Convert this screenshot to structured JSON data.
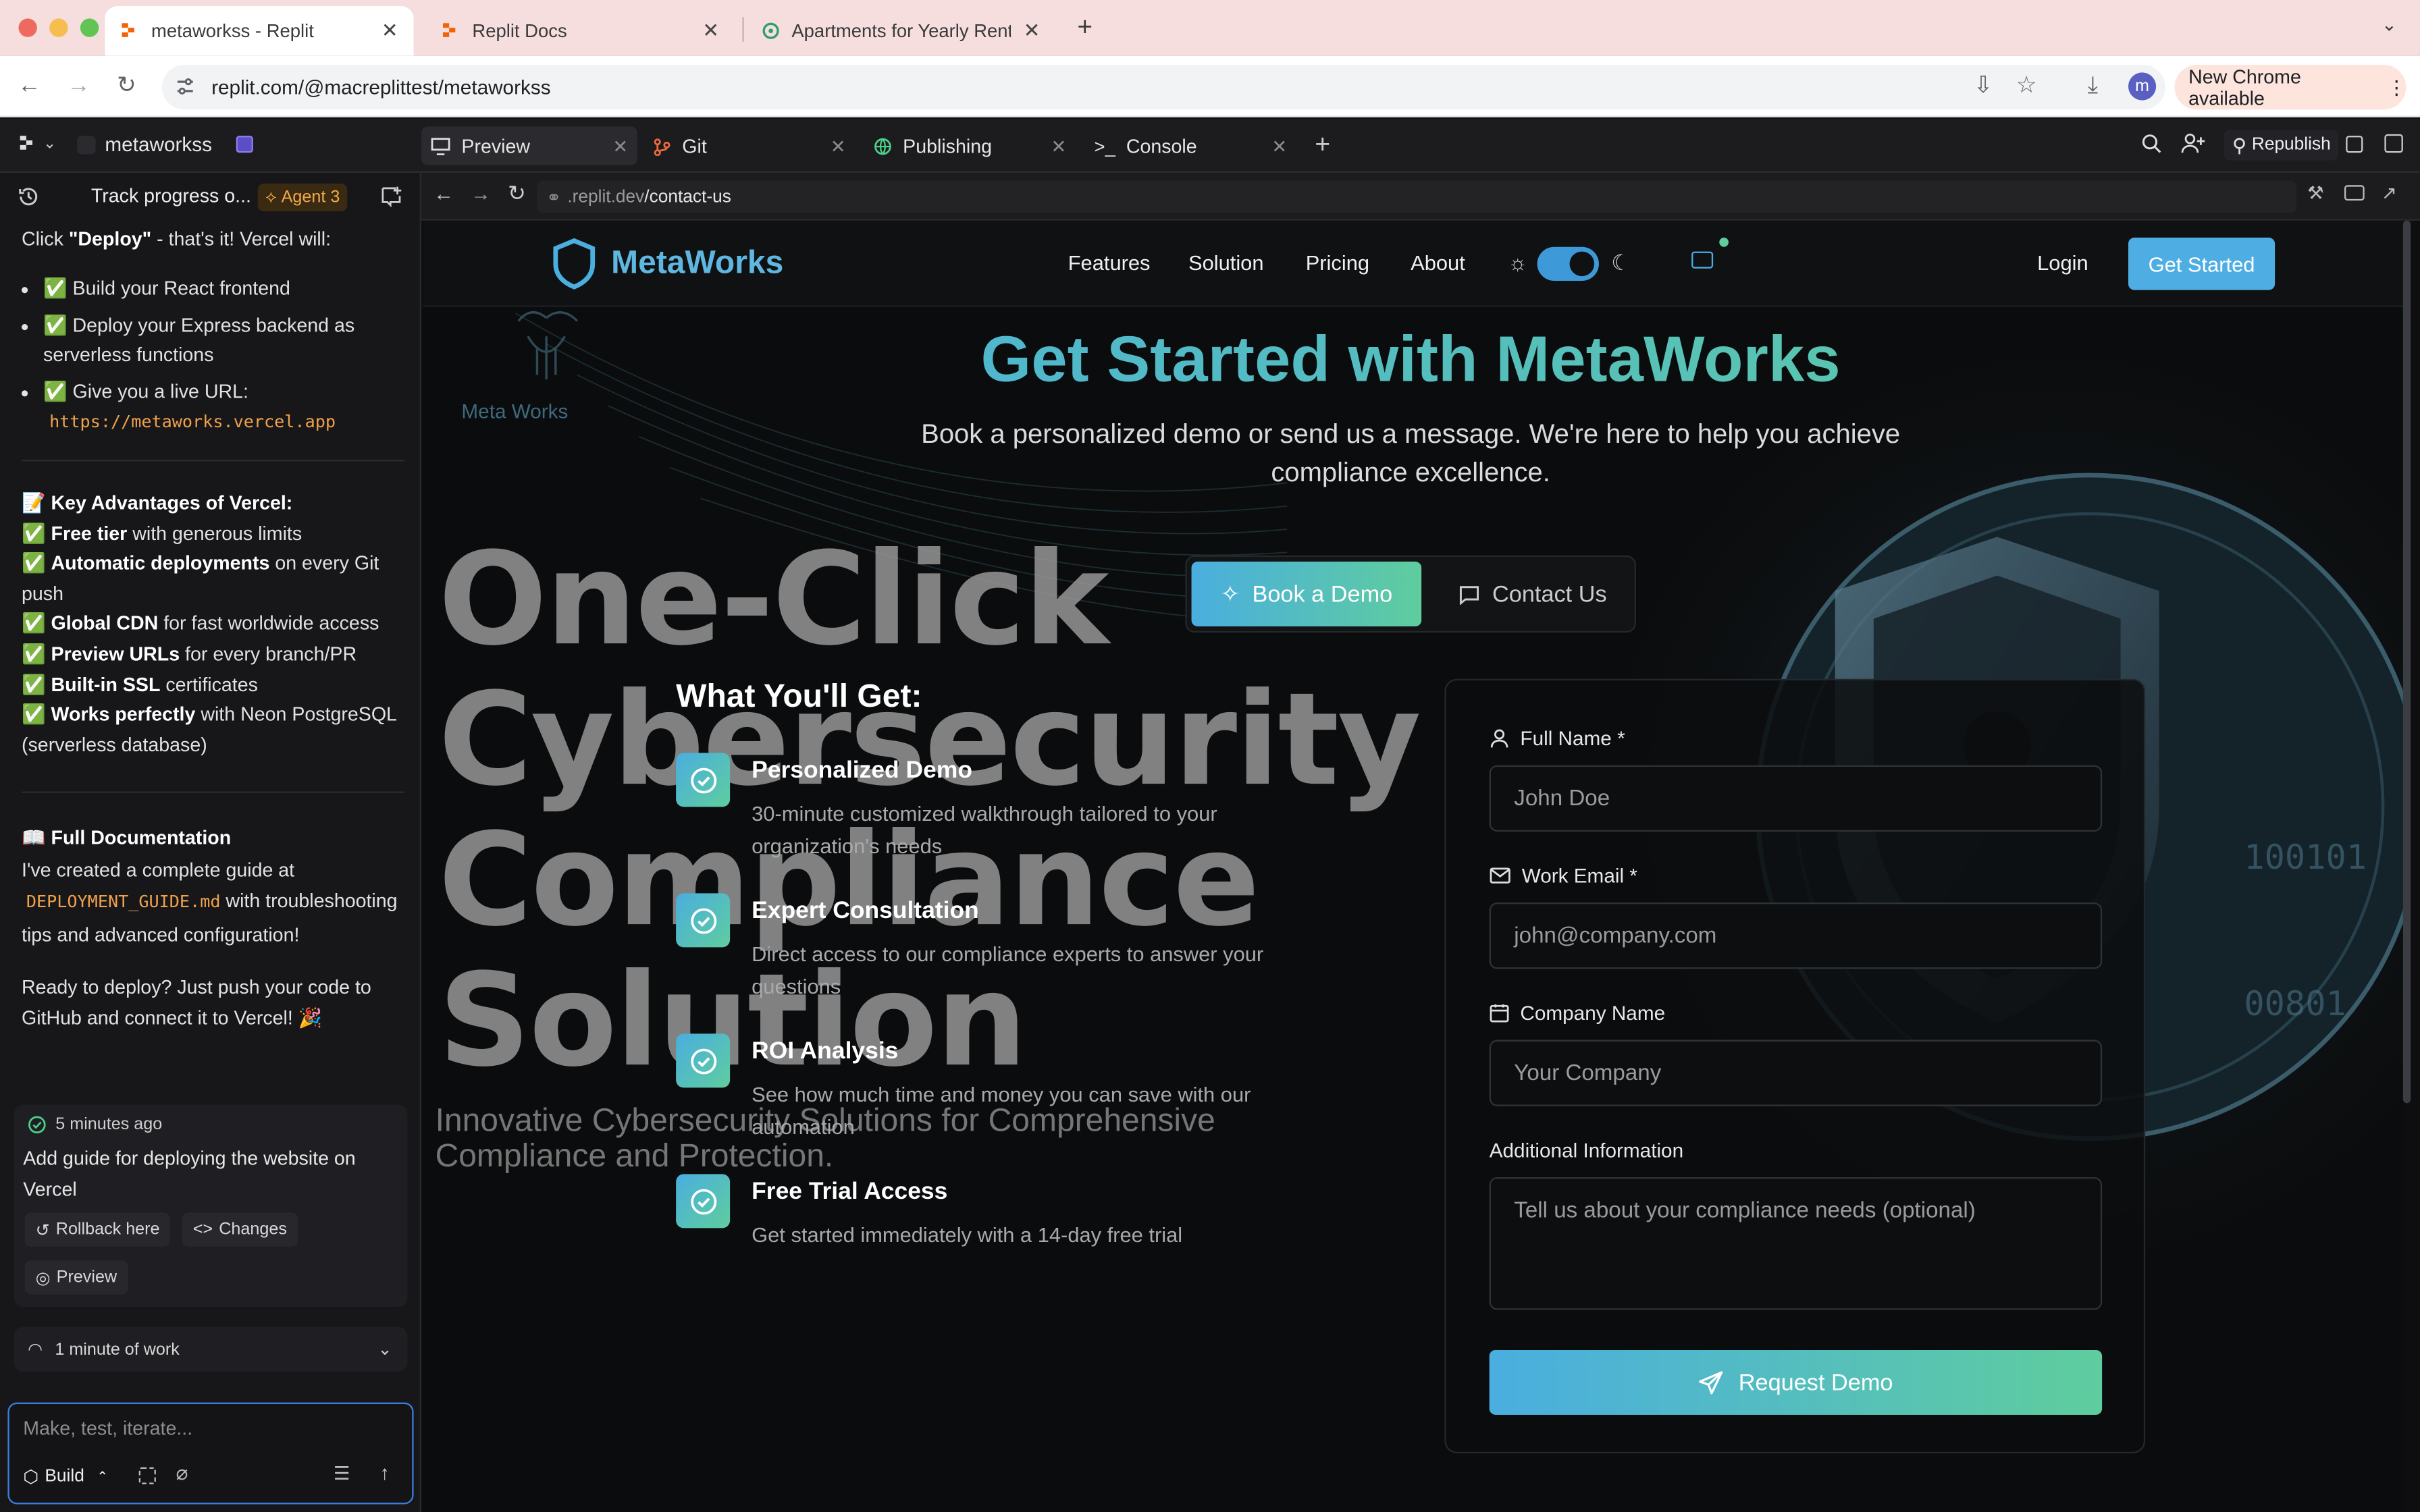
{
  "browser": {
    "tabs": [
      {
        "title": "metaworkss - Replit"
      },
      {
        "title": "Replit Docs"
      },
      {
        "title": "Apartments for Yearly Rent in"
      }
    ],
    "url": "replit.com/@macreplittest/metaworkss",
    "new_chrome_label": "New Chrome available",
    "profile_initial": "m"
  },
  "replit": {
    "project_name": "metaworkss",
    "tabs": [
      {
        "label": "Preview"
      },
      {
        "label": "Git"
      },
      {
        "label": "Publishing"
      },
      {
        "label": "Console"
      }
    ],
    "republish_label": "Republish",
    "chat_title": "Track progress o...",
    "agent_badge": "Agent 3",
    "chat": {
      "deploy_prefix": "Click ",
      "deploy_bold": "\"Deploy\"",
      "deploy_suffix": " - that's it! Vercel will:",
      "bullets": [
        "✅ Build your React frontend",
        "✅ Deploy your Express backend as serverless functions",
        "✅ Give you a live URL:"
      ],
      "live_url": "https://metaworks.vercel.app",
      "adv_heading": "📝 Key Advantages of Vercel:",
      "advantages": [
        {
          "bold": "Free tier",
          "rest": " with generous limits"
        },
        {
          "bold": "Automatic deployments",
          "rest": " on every Git push"
        },
        {
          "bold": "Global CDN",
          "rest": " for fast worldwide access"
        },
        {
          "bold": "Preview URLs",
          "rest": " for every branch/PR"
        },
        {
          "bold": "Built-in SSL",
          "rest": " certificates"
        },
        {
          "bold": "Works perfectly",
          "rest": " with Neon PostgreSQL (serverless database)"
        }
      ],
      "check": "✅ ",
      "doc_heading": "📖 Full Documentation",
      "doc_prefix": "I've created a complete guide at ",
      "doc_file": "DEPLOYMENT_GUIDE.md",
      "doc_suffix": " with troubleshooting tips and advanced configuration!",
      "closing": "Ready to deploy? Just push your code to GitHub and connect it to Vercel! 🎉"
    },
    "commit": {
      "time": "5 minutes ago",
      "message": "Add guide for deploying the website on Vercel",
      "rollback": "Rollback here",
      "changes": "Changes",
      "preview": "Preview"
    },
    "work_label": "1 minute of work",
    "input_placeholder": "Make, test, iterate...",
    "build_label": "Build",
    "preview_url_prefix": ".replit.dev",
    "preview_url_path": "/contact-us"
  },
  "site": {
    "brand": "MetaWorks",
    "nav": [
      "Features",
      "Solution",
      "Pricing",
      "About"
    ],
    "login": "Login",
    "get_started": "Get Started",
    "bg_logo_text": "Meta Works",
    "hero_title": "Get Started with MetaWorks",
    "hero_sub": "Book a personalized demo or send us a message. We're here to help you achieve compliance excellence.",
    "bg_headline": [
      "One-Click",
      "Cybersecurity",
      "Compliance",
      "Solution"
    ],
    "bg_sub": "Innovative Cybersecurity Solutions for Comprehensive Compliance and Protection.",
    "book_demo": "Book a Demo",
    "contact_us": "Contact Us",
    "what_heading": "What You'll Get:",
    "features": [
      {
        "title": "Personalized Demo",
        "desc": "30-minute customized walkthrough tailored to your organization's needs"
      },
      {
        "title": "Expert Consultation",
        "desc": "Direct access to our compliance experts to answer your questions"
      },
      {
        "title": "ROI Analysis",
        "desc": "See how much time and money you can save with our automation"
      },
      {
        "title": "Free Trial Access",
        "desc": "Get started immediately with a 14-day free trial"
      }
    ],
    "form": {
      "full_name_label": "Full Name *",
      "full_name_ph": "John Doe",
      "email_label": "Work Email *",
      "email_ph": "john@company.com",
      "company_label": "Company Name",
      "company_ph": "Your Company",
      "info_label": "Additional Information",
      "info_ph": "Tell us about your compliance needs (optional)",
      "submit": "Request Demo"
    }
  },
  "colors": {
    "accent_blue": "#4aaedf",
    "accent_green": "#5fcd9e",
    "agent_orange": "#f0a94b"
  }
}
